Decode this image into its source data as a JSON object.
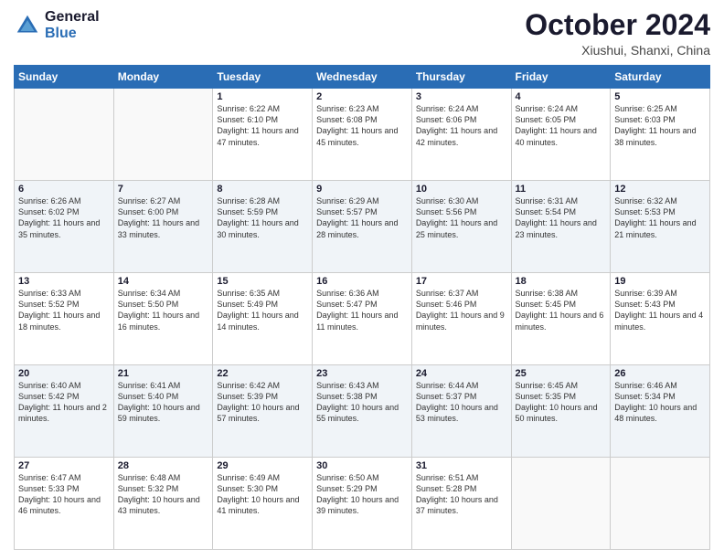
{
  "header": {
    "logo_line1": "General",
    "logo_line2": "Blue",
    "main_title": "October 2024",
    "subtitle": "Xiushui, Shanxi, China"
  },
  "days_of_week": [
    "Sunday",
    "Monday",
    "Tuesday",
    "Wednesday",
    "Thursday",
    "Friday",
    "Saturday"
  ],
  "weeks": [
    [
      {
        "day": "",
        "info": ""
      },
      {
        "day": "",
        "info": ""
      },
      {
        "day": "1",
        "info": "Sunrise: 6:22 AM\nSunset: 6:10 PM\nDaylight: 11 hours and 47 minutes."
      },
      {
        "day": "2",
        "info": "Sunrise: 6:23 AM\nSunset: 6:08 PM\nDaylight: 11 hours and 45 minutes."
      },
      {
        "day": "3",
        "info": "Sunrise: 6:24 AM\nSunset: 6:06 PM\nDaylight: 11 hours and 42 minutes."
      },
      {
        "day": "4",
        "info": "Sunrise: 6:24 AM\nSunset: 6:05 PM\nDaylight: 11 hours and 40 minutes."
      },
      {
        "day": "5",
        "info": "Sunrise: 6:25 AM\nSunset: 6:03 PM\nDaylight: 11 hours and 38 minutes."
      }
    ],
    [
      {
        "day": "6",
        "info": "Sunrise: 6:26 AM\nSunset: 6:02 PM\nDaylight: 11 hours and 35 minutes."
      },
      {
        "day": "7",
        "info": "Sunrise: 6:27 AM\nSunset: 6:00 PM\nDaylight: 11 hours and 33 minutes."
      },
      {
        "day": "8",
        "info": "Sunrise: 6:28 AM\nSunset: 5:59 PM\nDaylight: 11 hours and 30 minutes."
      },
      {
        "day": "9",
        "info": "Sunrise: 6:29 AM\nSunset: 5:57 PM\nDaylight: 11 hours and 28 minutes."
      },
      {
        "day": "10",
        "info": "Sunrise: 6:30 AM\nSunset: 5:56 PM\nDaylight: 11 hours and 25 minutes."
      },
      {
        "day": "11",
        "info": "Sunrise: 6:31 AM\nSunset: 5:54 PM\nDaylight: 11 hours and 23 minutes."
      },
      {
        "day": "12",
        "info": "Sunrise: 6:32 AM\nSunset: 5:53 PM\nDaylight: 11 hours and 21 minutes."
      }
    ],
    [
      {
        "day": "13",
        "info": "Sunrise: 6:33 AM\nSunset: 5:52 PM\nDaylight: 11 hours and 18 minutes."
      },
      {
        "day": "14",
        "info": "Sunrise: 6:34 AM\nSunset: 5:50 PM\nDaylight: 11 hours and 16 minutes."
      },
      {
        "day": "15",
        "info": "Sunrise: 6:35 AM\nSunset: 5:49 PM\nDaylight: 11 hours and 14 minutes."
      },
      {
        "day": "16",
        "info": "Sunrise: 6:36 AM\nSunset: 5:47 PM\nDaylight: 11 hours and 11 minutes."
      },
      {
        "day": "17",
        "info": "Sunrise: 6:37 AM\nSunset: 5:46 PM\nDaylight: 11 hours and 9 minutes."
      },
      {
        "day": "18",
        "info": "Sunrise: 6:38 AM\nSunset: 5:45 PM\nDaylight: 11 hours and 6 minutes."
      },
      {
        "day": "19",
        "info": "Sunrise: 6:39 AM\nSunset: 5:43 PM\nDaylight: 11 hours and 4 minutes."
      }
    ],
    [
      {
        "day": "20",
        "info": "Sunrise: 6:40 AM\nSunset: 5:42 PM\nDaylight: 11 hours and 2 minutes."
      },
      {
        "day": "21",
        "info": "Sunrise: 6:41 AM\nSunset: 5:40 PM\nDaylight: 10 hours and 59 minutes."
      },
      {
        "day": "22",
        "info": "Sunrise: 6:42 AM\nSunset: 5:39 PM\nDaylight: 10 hours and 57 minutes."
      },
      {
        "day": "23",
        "info": "Sunrise: 6:43 AM\nSunset: 5:38 PM\nDaylight: 10 hours and 55 minutes."
      },
      {
        "day": "24",
        "info": "Sunrise: 6:44 AM\nSunset: 5:37 PM\nDaylight: 10 hours and 53 minutes."
      },
      {
        "day": "25",
        "info": "Sunrise: 6:45 AM\nSunset: 5:35 PM\nDaylight: 10 hours and 50 minutes."
      },
      {
        "day": "26",
        "info": "Sunrise: 6:46 AM\nSunset: 5:34 PM\nDaylight: 10 hours and 48 minutes."
      }
    ],
    [
      {
        "day": "27",
        "info": "Sunrise: 6:47 AM\nSunset: 5:33 PM\nDaylight: 10 hours and 46 minutes."
      },
      {
        "day": "28",
        "info": "Sunrise: 6:48 AM\nSunset: 5:32 PM\nDaylight: 10 hours and 43 minutes."
      },
      {
        "day": "29",
        "info": "Sunrise: 6:49 AM\nSunset: 5:30 PM\nDaylight: 10 hours and 41 minutes."
      },
      {
        "day": "30",
        "info": "Sunrise: 6:50 AM\nSunset: 5:29 PM\nDaylight: 10 hours and 39 minutes."
      },
      {
        "day": "31",
        "info": "Sunrise: 6:51 AM\nSunset: 5:28 PM\nDaylight: 10 hours and 37 minutes."
      },
      {
        "day": "",
        "info": ""
      },
      {
        "day": "",
        "info": ""
      }
    ]
  ]
}
